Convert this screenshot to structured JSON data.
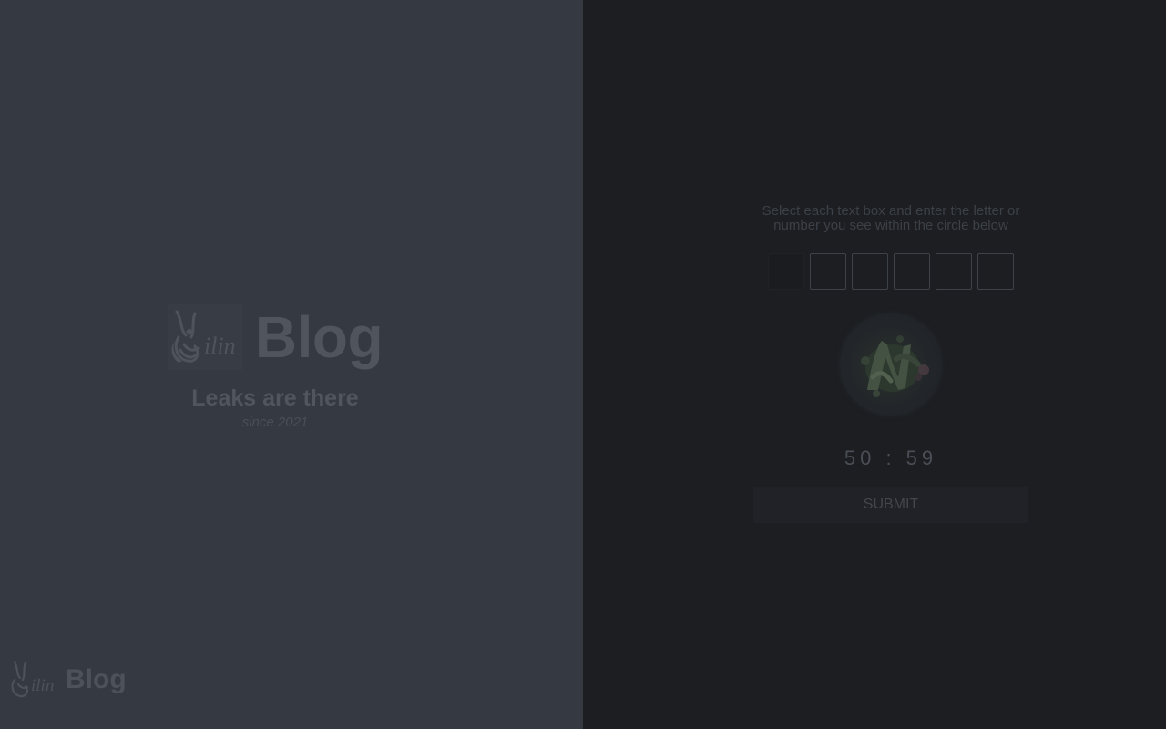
{
  "brand": {
    "name": "Blog",
    "tagline": "Leaks are there",
    "since": "since 2021",
    "logo_text": "Qilin"
  },
  "footer": {
    "name": "Blog",
    "logo_text": "Qilin"
  },
  "captcha": {
    "instruction": "Select each text box and enter the letter or number you see within the circle below",
    "box_count": 6,
    "timer": "50 : 59",
    "submit_label": "SUBMIT",
    "image_icon": "captcha-letter-image"
  },
  "colors": {
    "left_background": "#353942",
    "right_background": "#1c1e22"
  }
}
